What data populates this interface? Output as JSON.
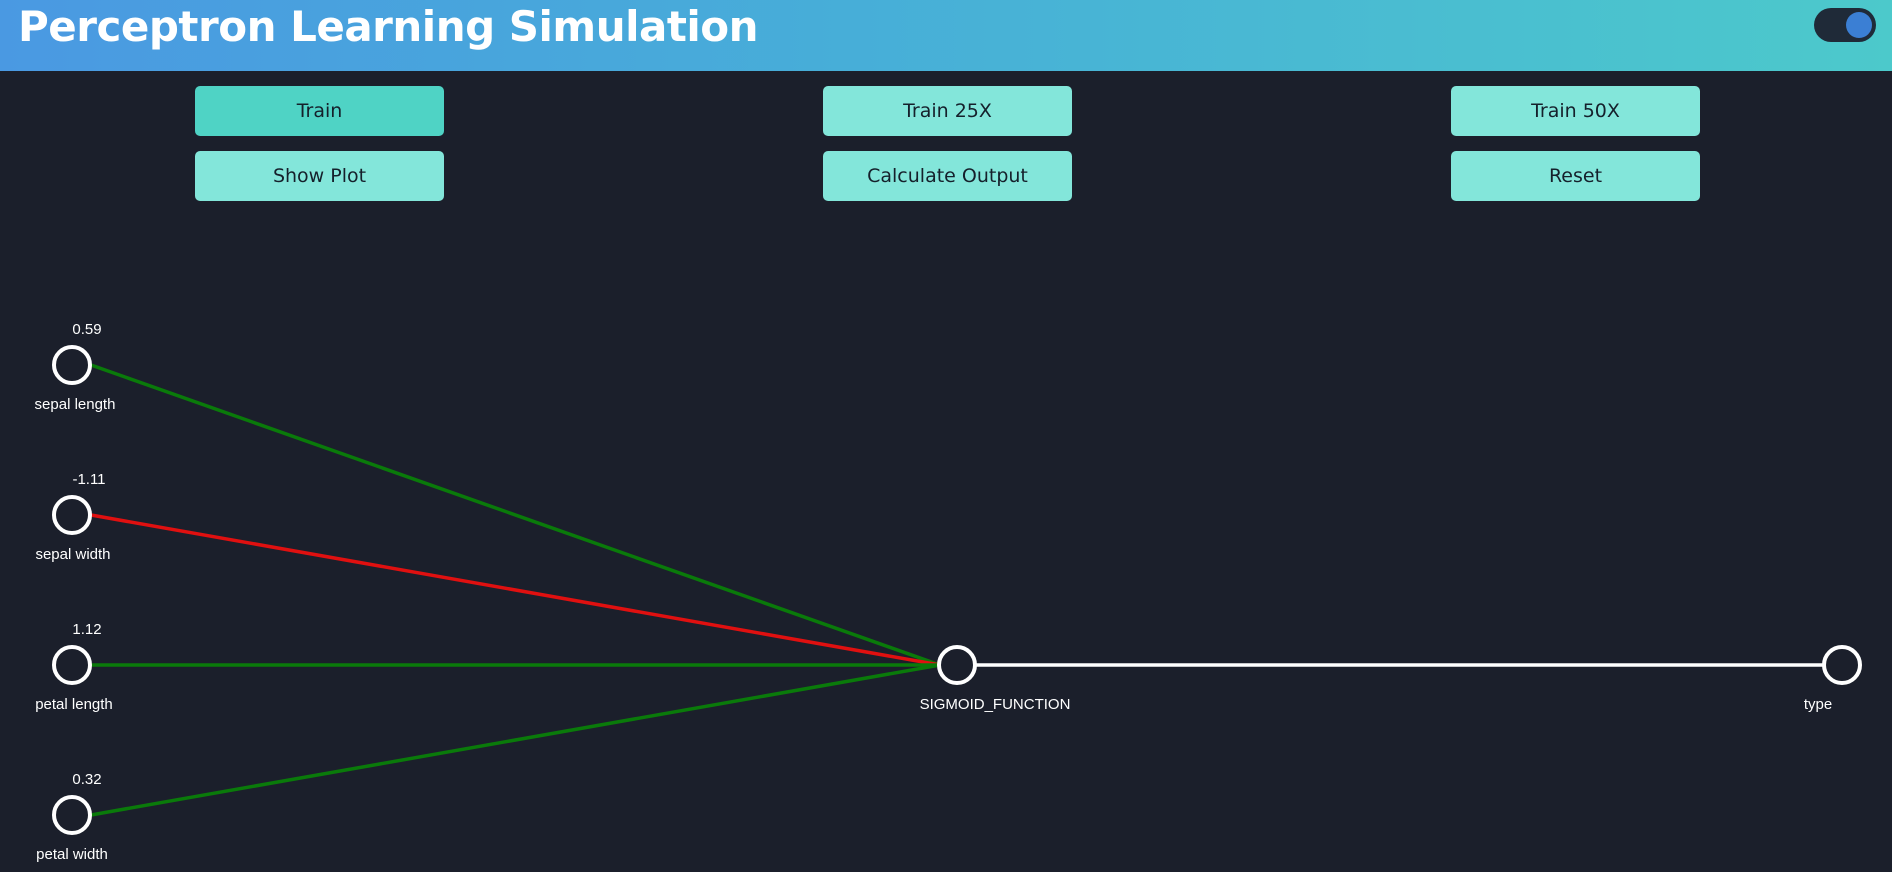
{
  "header": {
    "title": "Perceptron Learning Simulation",
    "theme_toggle_on": true
  },
  "controls": {
    "train_label": "Train",
    "train25_label": "Train 25X",
    "train50_label": "Train 50X",
    "show_plot_label": "Show Plot",
    "calculate_label": "Calculate Output",
    "reset_label": "Reset"
  },
  "network": {
    "inputs": [
      {
        "label": "sepal length",
        "weight": "0.59"
      },
      {
        "label": "sepal width",
        "weight": "-1.11"
      },
      {
        "label": "petal length",
        "weight": "1.12"
      },
      {
        "label": "petal width",
        "weight": "0.32"
      }
    ],
    "activation": {
      "label": "SIGMOID_FUNCTION"
    },
    "output": {
      "label": "type"
    }
  },
  "colors": {
    "positive_weight": "#0a7a0a",
    "negative_weight": "#e01010",
    "connection": "#ffffff",
    "node_stroke": "#ffffff"
  }
}
